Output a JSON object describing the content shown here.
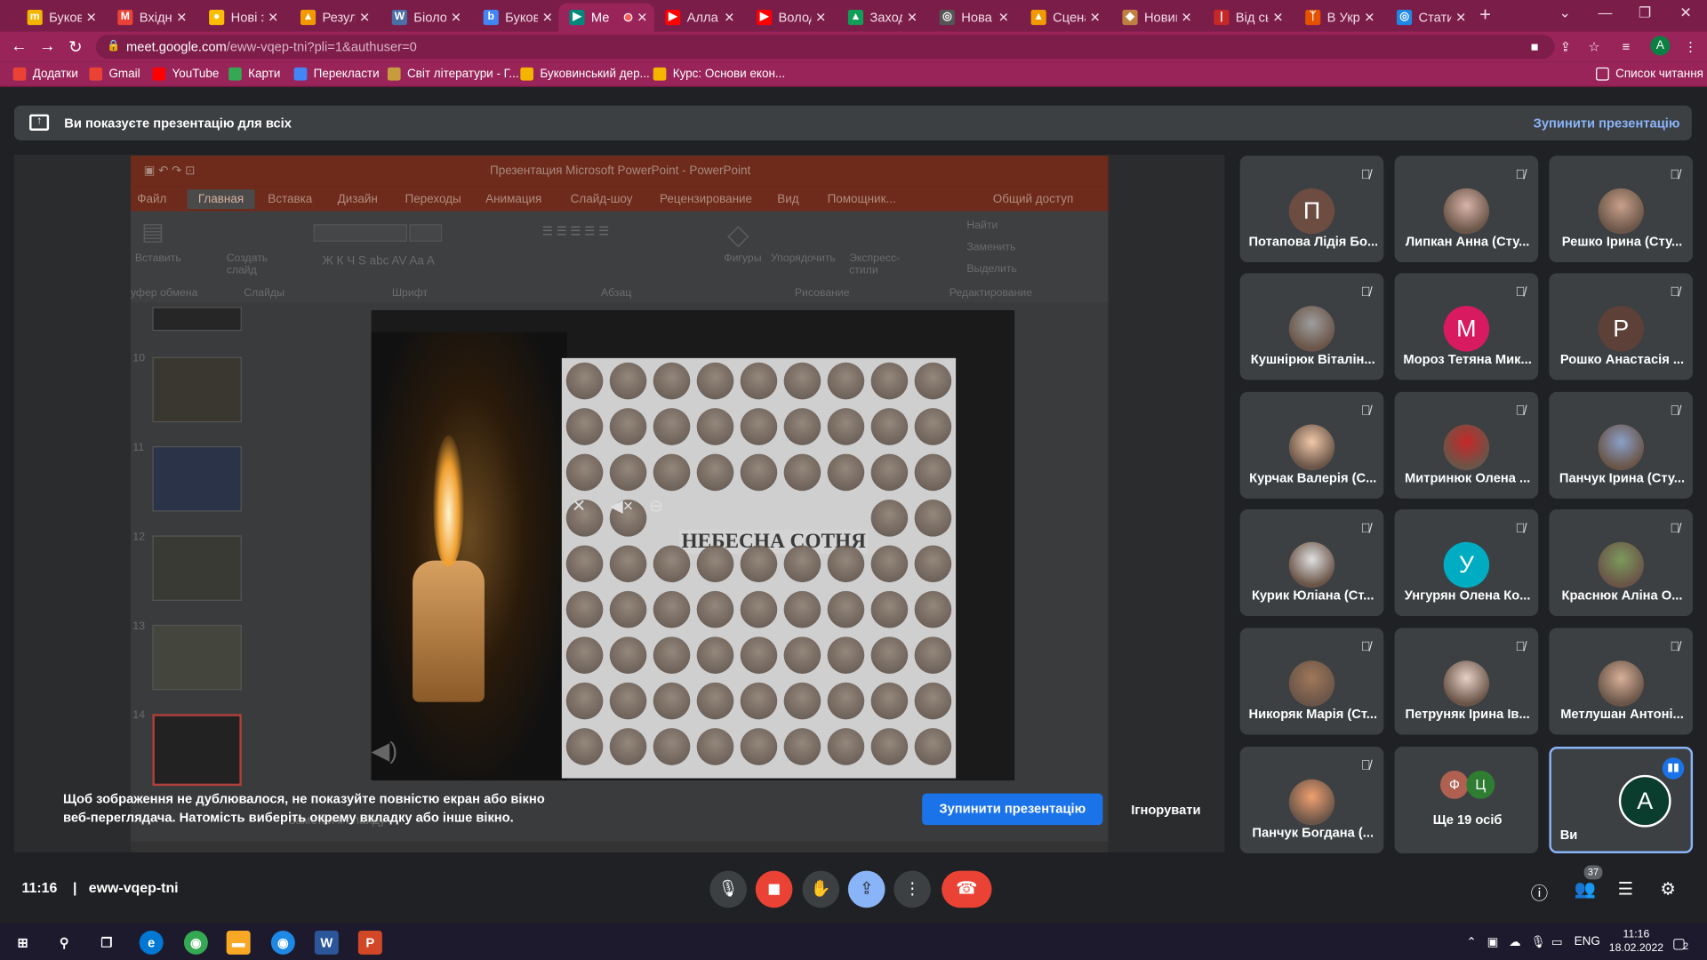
{
  "browser": {
    "tabs": [
      {
        "title": "Букови",
        "fav": "m",
        "color": "#f4b400"
      },
      {
        "title": "Вхідні (",
        "fav": "M",
        "color": "#ea4335"
      },
      {
        "title": "Нові зн",
        "fav": "●",
        "color": "#fbbc04"
      },
      {
        "title": "Резуль",
        "fav": "▲",
        "color": "#f29900"
      },
      {
        "title": "Біологі",
        "fav": "W",
        "color": "#4a6fa5"
      },
      {
        "title": "Букови",
        "fav": "b",
        "color": "#4285f4"
      },
      {
        "title": "Ме",
        "fav": "▶",
        "color": "#00897b"
      },
      {
        "title": "Алла П",
        "fav": "▶",
        "color": "#ff0000"
      },
      {
        "title": "Володи",
        "fav": "▶",
        "color": "#ff0000"
      },
      {
        "title": "Заходи",
        "fav": "▲",
        "color": "#0f9d58"
      },
      {
        "title": "Нова в",
        "fav": "◎",
        "color": "#555555"
      },
      {
        "title": "Сценар",
        "fav": "▲",
        "color": "#f29900"
      },
      {
        "title": "Новин",
        "fav": "◆",
        "color": "#c08040"
      },
      {
        "title": "Від сьо",
        "fav": "|",
        "color": "#c62828"
      },
      {
        "title": "В Укра",
        "fav": "ᛉ",
        "color": "#e65100"
      },
      {
        "title": "Стати",
        "fav": "◎",
        "color": "#1e88e5"
      }
    ],
    "url_host": "meet.google.com",
    "url_path": "/eww-vqep-tni?pli=1&authuser=0",
    "profile_letter": "A",
    "bookmarks": [
      "Додатки",
      "Gmail",
      "YouTube",
      "Карти",
      "Перекласти",
      "Світ літератури - Г...",
      "Буковинський дер...",
      "Курс: Основи екон..."
    ],
    "reading_list": "Список читання"
  },
  "banner": {
    "text": "Ви показуєте презентацію для всіх",
    "stop": "Зупинити презентацію"
  },
  "ppt": {
    "title": "Презентация Microsoft PowerPoint - PowerPoint",
    "menu": [
      "Файл",
      "Главная",
      "Вставка",
      "Дизайн",
      "Переходы",
      "Анимация",
      "Слайд-шоу",
      "Рецензирование",
      "Вид",
      "Помощник...",
      "Общий доступ"
    ],
    "ribbon": {
      "paste": "Вставить",
      "create": "Создать слайд",
      "shapes": "Фигуры",
      "arrange": "Упорядочить",
      "express": "Экспресс-стили",
      "find": "Найти",
      "replace": "Заменить",
      "select": "Выделить",
      "groups": [
        "уфер обмена",
        "Слайды",
        "Шрифт",
        "Абзац",
        "Рисование",
        "Редактирование"
      ]
    },
    "thumbs": [
      "10",
      "11",
      "12",
      "13",
      "14"
    ],
    "slide_caption": "НЕБЕСНА СОТНЯ",
    "notes": "Заметки к слайду"
  },
  "warning": {
    "message": "Щоб зображення не дублювалося, не показуйте повністю екран або вікно веб-переглядача. Натомість виберіть окрему вкладку або інше вікно.",
    "stop": "Зупинити презентацію",
    "ignore": "Ігнорувати"
  },
  "participants": [
    {
      "name": "Потапова Лідія Бо...",
      "initial": "П",
      "color": "#6d4c41",
      "photo": false
    },
    {
      "name": "Липкан Анна (Сту...",
      "initial": "",
      "color": "#d8b4a8",
      "photo": true
    },
    {
      "name": "Решко Ірина (Сту...",
      "initial": "",
      "color": "#c9a08a",
      "photo": true
    },
    {
      "name": "Кушнірюк Віталін...",
      "initial": "",
      "color": "#9e9e9e",
      "photo": true
    },
    {
      "name": "Мороз Тетяна Мик...",
      "initial": "М",
      "color": "#d81b60",
      "photo": false
    },
    {
      "name": "Рошко Анастасія ...",
      "initial": "Р",
      "color": "#5d4037",
      "photo": false
    },
    {
      "name": "Курчак Валерія (С...",
      "initial": "",
      "color": "#f0c8a8",
      "photo": true
    },
    {
      "name": "Митринюк Олена ...",
      "initial": "",
      "color": "#c62828",
      "photo": true
    },
    {
      "name": "Панчук Ірина (Сту...",
      "initial": "",
      "color": "#8aa0c8",
      "photo": true
    },
    {
      "name": "Курик Юліана (Ст...",
      "initial": "",
      "color": "#e0e0e0",
      "photo": true
    },
    {
      "name": "Унгурян Олена Ко...",
      "initial": "У",
      "color": "#00acc1",
      "photo": false
    },
    {
      "name": "Краснюк Аліна О...",
      "initial": "",
      "color": "#7c9a5c",
      "photo": true
    },
    {
      "name": "Никоряк Марія (Ст...",
      "initial": "",
      "color": "#a0785a",
      "photo": true
    },
    {
      "name": "Петруняк Ірина Ів...",
      "initial": "",
      "color": "#e8d0c8",
      "photo": true
    },
    {
      "name": "Метлушан Антоні...",
      "initial": "",
      "color": "#d8b098",
      "photo": true
    },
    {
      "name": "Панчук Богдана (...",
      "initial": "",
      "color": "#f0a070",
      "photo": true
    }
  ],
  "more_tile": {
    "label": "Ще 19 осіб",
    "a1": "Ф",
    "a2": "Ц"
  },
  "you_tile": {
    "label": "Ви",
    "initial": "A"
  },
  "controls": {
    "time": "11:16",
    "meeting_code": "eww-vqep-tni",
    "people_count": "37"
  },
  "taskbar": {
    "lang": "ENG",
    "time": "11:16",
    "date": "18.02.2022",
    "notif": "2"
  }
}
